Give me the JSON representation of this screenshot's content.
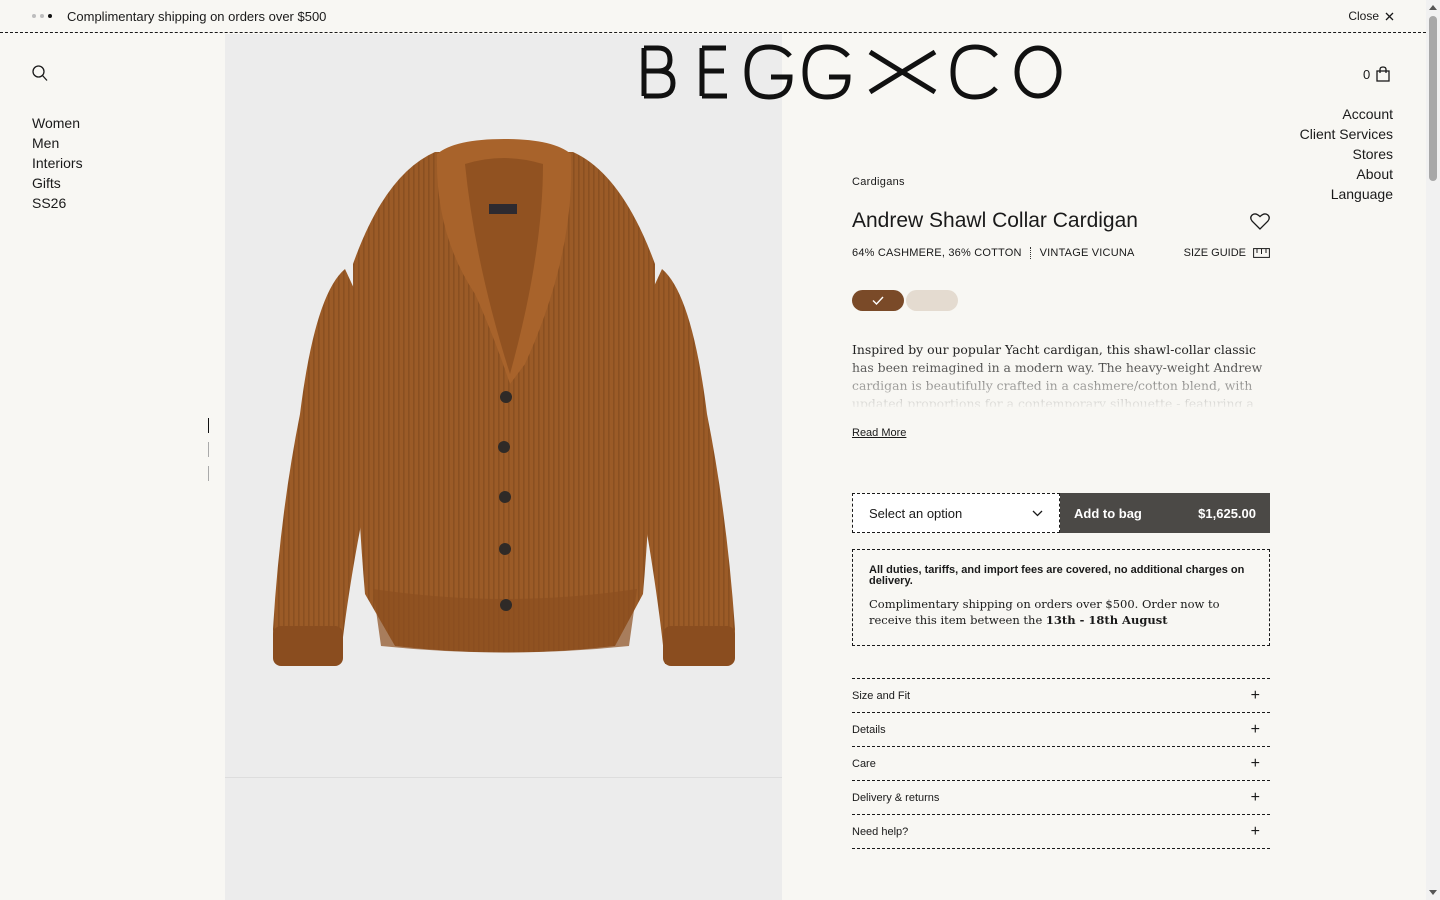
{
  "announcement": {
    "text": "Complimentary shipping on orders over $500",
    "close_label": "Close",
    "slides": 3
  },
  "brand": {
    "logo_text": "BEGG & CO"
  },
  "left_nav": [
    "Women",
    "Men",
    "Interiors",
    "Gifts",
    "SS26"
  ],
  "right_nav": [
    "Account",
    "Client Services",
    "Stores",
    "About",
    "Language"
  ],
  "bag": {
    "count": "0"
  },
  "product": {
    "category": "Cardigans",
    "title": "Andrew Shawl Collar Cardigan",
    "composition": "64% CASHMERE, 36% COTTON",
    "color_name": "VINTAGE VICUNA",
    "size_guide_label": "SIZE GUIDE",
    "swatches": [
      {
        "color": "#7a4a28",
        "selected": true
      },
      {
        "color": "#e4dbd0",
        "selected": false
      }
    ],
    "description": "Inspired by our popular Yacht cardigan, this shawl-collar classic has been reimagined in a modern way. The heavy-weight Andrew cardigan is beautifully crafted in a cashmere/cotton blend, with updated proportions for a contemporary silhouette - featuring a slightly shorter",
    "read_more_label": "Read More",
    "select_placeholder": "Select an option",
    "add_to_bag_label": "Add to bag",
    "price": "$1,625.00",
    "garment_color": "#9b5b27"
  },
  "notice": {
    "bold": "All duties, tariffs, and import fees are covered, no additional charges on delivery.",
    "text": "Complimentary shipping on orders over $500. Order now to receive this item between the",
    "date_range": "13th - 18th August"
  },
  "accordion": [
    "Size and Fit",
    "Details",
    "Care",
    "Delivery & returns",
    "Need help?"
  ],
  "gallery": {
    "current": 1,
    "total": 3
  }
}
